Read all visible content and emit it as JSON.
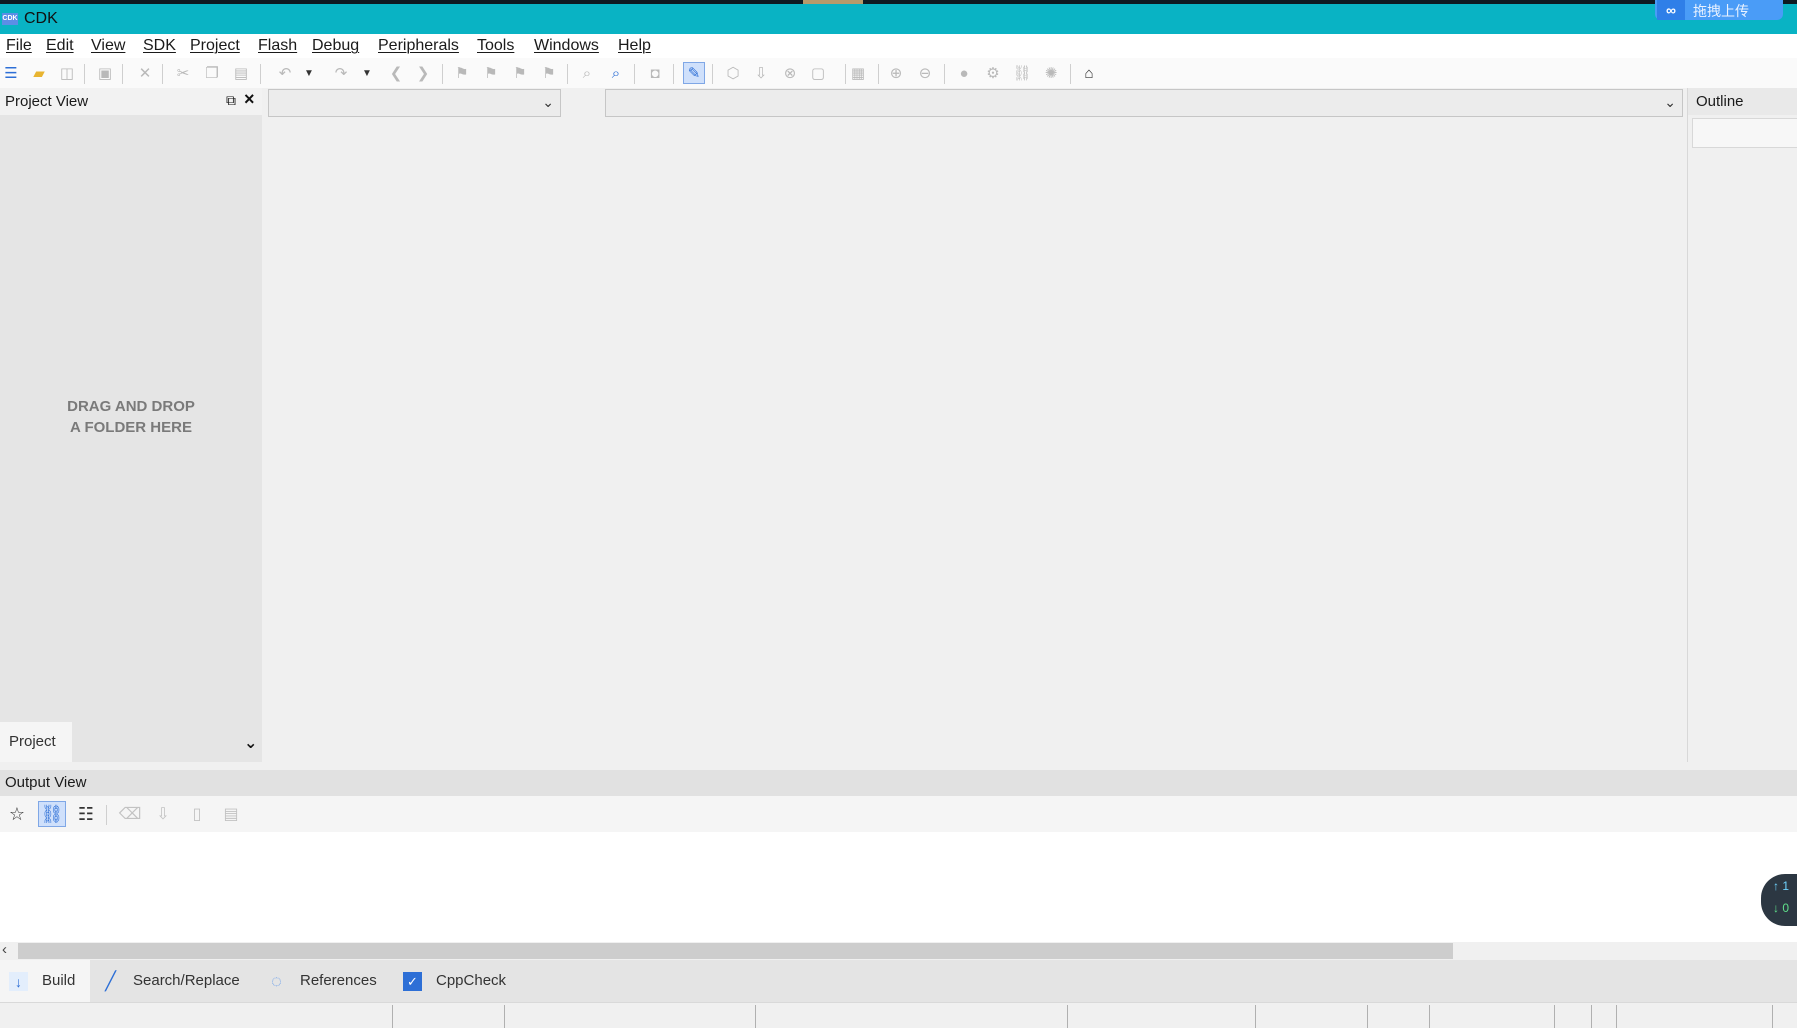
{
  "window": {
    "title": "CDK",
    "app_icon_text": "CDK"
  },
  "overlay": {
    "upload_label": "拖拽上传",
    "upload_icon": "baidu-netdisk-icon",
    "net_up": "↑ 1",
    "net_down": "↓ 0"
  },
  "menubar": {
    "items": [
      "File",
      "Edit",
      "View",
      "SDK",
      "Project",
      "Flash",
      "Debug",
      "Peripherals",
      "Tools",
      "Windows",
      "Help"
    ]
  },
  "toolbar": {
    "icons": [
      "new-file-icon",
      "open-folder-icon",
      "refresh-icon",
      "save-icon",
      "close-icon",
      "cut-icon",
      "copy-icon",
      "paste-icon",
      "undo-icon",
      "undo-dropdown-icon",
      "redo-icon",
      "redo-dropdown-icon",
      "back-icon",
      "forward-icon",
      "bookmark-icon",
      "bookmark-next-icon",
      "bookmark-prev-icon",
      "bookmark-clear-icon",
      "find-icon",
      "find-in-files-icon",
      "screenshot-icon",
      "edit-active-icon",
      "build-icon",
      "download-icon",
      "stop-icon",
      "clean-icon",
      "layout-icon",
      "zoom-in-icon",
      "zoom-out-icon",
      "breakpoint-icon",
      "connect-icon",
      "link-icon",
      "disconnect-icon",
      "home-icon"
    ]
  },
  "project_view": {
    "title": "Project View",
    "placeholder": "DRAG AND DROP\nA FOLDER HERE",
    "tab_label": "Project"
  },
  "editor": {
    "file_combo_value": "",
    "symbol_combo_value": ""
  },
  "outline": {
    "title": "Outline"
  },
  "output_view": {
    "title": "Output View"
  },
  "bottom_tabs": [
    {
      "label": "Build",
      "icon": "build-download-icon",
      "color": "#2d6fd6"
    },
    {
      "label": "Search/Replace",
      "icon": "pencil-icon",
      "color": "#2d6fd6"
    },
    {
      "label": "References",
      "icon": "loading-circle-icon",
      "color": "#2d6fd6"
    },
    {
      "label": "CppCheck",
      "icon": "checkbox-icon",
      "color": "#2d6fd6"
    }
  ],
  "colors": {
    "titlebar": "#09b3c4",
    "accent": "#2d6fd6"
  }
}
